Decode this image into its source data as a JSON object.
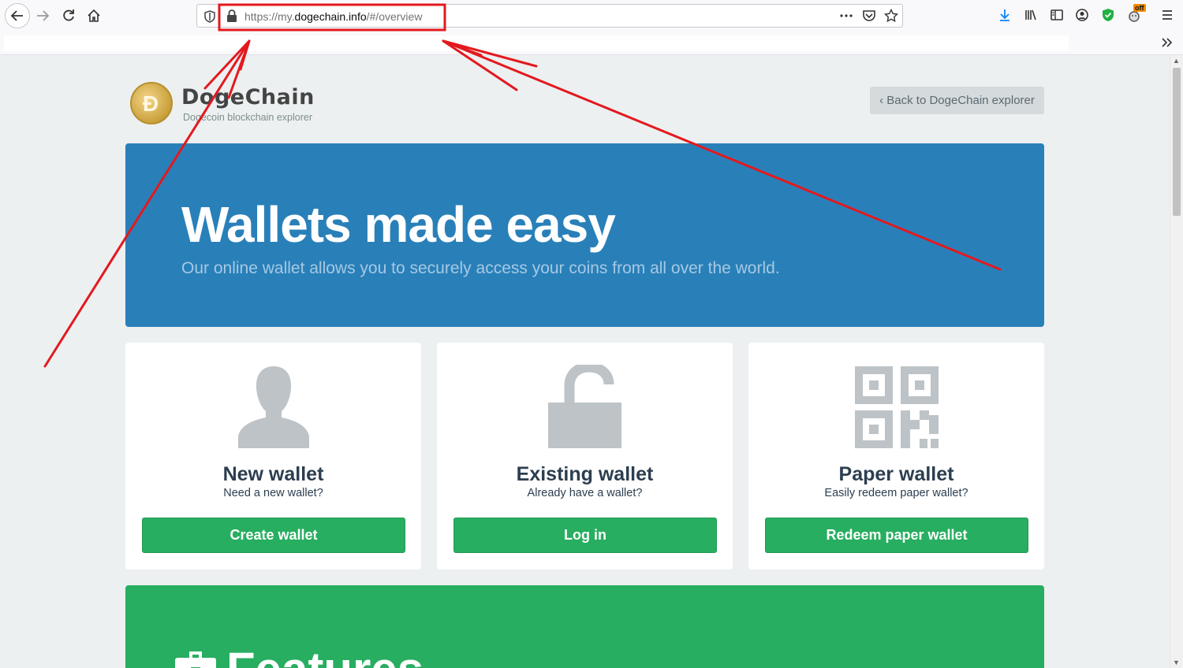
{
  "browser": {
    "url_prefix": "https://my.",
    "url_domain": "dogechain.info",
    "url_suffix": "/#/overview",
    "extension_badge": "off"
  },
  "header": {
    "logo_title": "DogeChain",
    "logo_subtitle": "Dogecoin blockchain explorer",
    "back_button_label": "‹ Back to DogeChain explorer"
  },
  "hero": {
    "title": "Wallets made easy",
    "subtitle": "Our online wallet allows you to securely access your coins from all over the world."
  },
  "cards": [
    {
      "title": "New wallet",
      "subtitle": "Need a new wallet?",
      "button": "Create wallet",
      "icon": "user-icon"
    },
    {
      "title": "Existing wallet",
      "subtitle": "Already have a wallet?",
      "button": "Log in",
      "icon": "unlock-icon"
    },
    {
      "title": "Paper wallet",
      "subtitle": "Easily redeem paper wallet?",
      "button": "Redeem paper wallet",
      "icon": "qr-code-icon"
    }
  ],
  "features": {
    "title": "Features",
    "icon": "briefcase-icon"
  },
  "colors": {
    "hero": "#2980b9",
    "success": "#27ae60",
    "page_bg": "#ecf0f1",
    "annotation": "#e3191e"
  }
}
